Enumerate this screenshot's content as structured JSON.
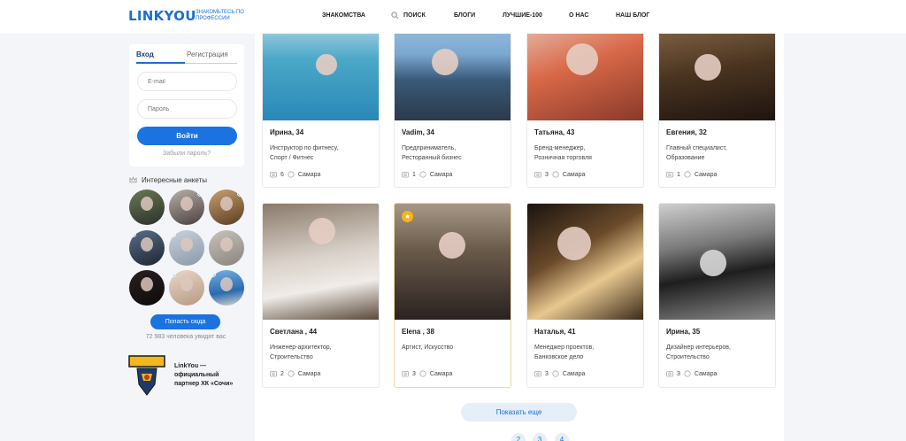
{
  "header": {
    "logo": "LINKYOU",
    "tagline": "ЗНАКОМЬТЕСЬ ПО ПРОФЕССИИ",
    "nav": [
      "ЗНАКОМСТВА",
      "ПОИСК",
      "БЛОГИ",
      "ЛУЧШИЕ-100",
      "О НАС",
      "НАШ БЛОГ"
    ]
  },
  "login": {
    "tab_login": "Вход",
    "tab_register": "Регистрация",
    "email_placeholder": "E-mail",
    "password_placeholder": "Пароль",
    "submit": "Войти",
    "forgot": "Забыли пароль?"
  },
  "interesting": {
    "title": "Интересные анкеты",
    "cta": "Попасть сюда",
    "viewers": "72 983 человека увидят вас"
  },
  "partner": {
    "text": "LinkYou — официальный партнер ХК «Сочи»"
  },
  "profiles": [
    {
      "name": "Ирина, 34",
      "desc1": "Инструктор по фитнесу,",
      "desc2": "Спорт / Фитнес",
      "photos": "6",
      "city": "Самара"
    },
    {
      "name": "Vadim, 34",
      "desc1": "Предприниматель,",
      "desc2": "Ресторанный бизнес",
      "photos": "1",
      "city": "Самара"
    },
    {
      "name": "Татьяна, 43",
      "desc1": "Бренд-менеджер,",
      "desc2": "Розничная торговля",
      "photos": "3",
      "city": "Самара"
    },
    {
      "name": "Евгения, 32",
      "desc1": "Главный специалист,",
      "desc2": "Образование",
      "photos": "1",
      "city": "Самара"
    },
    {
      "name": "Светлана , 44",
      "desc1": "Инженер-архитектор,",
      "desc2": "Строительство",
      "photos": "2",
      "city": "Самара"
    },
    {
      "name": "Elena , 38",
      "desc1": "Артист, Искусство",
      "desc2": "",
      "photos": "3",
      "city": "Самара"
    },
    {
      "name": "Наталья, 41",
      "desc1": "Менеджер проектов,",
      "desc2": "Банковское дело",
      "photos": "3",
      "city": "Самара"
    },
    {
      "name": "Ирина, 35",
      "desc1": "Дизайнер интерьеров,",
      "desc2": "Строительство",
      "photos": "3",
      "city": "Самара"
    }
  ],
  "more_button": "Показать еще",
  "pager": [
    "2",
    "3",
    "4"
  ],
  "colors": {
    "accent": "#1a73e0",
    "featured_star": "#f3b51c"
  }
}
